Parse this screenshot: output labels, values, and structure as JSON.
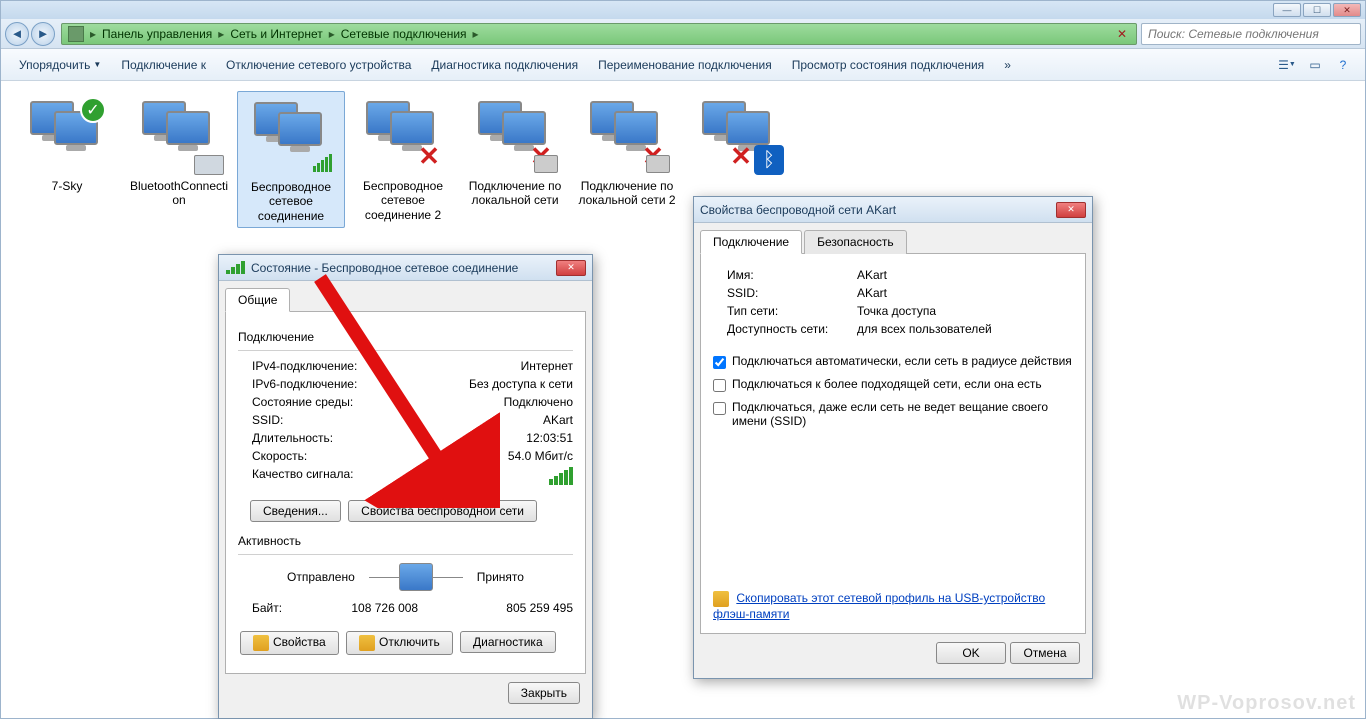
{
  "breadcrumb": {
    "items": [
      "Панель управления",
      "Сеть и Интернет",
      "Сетевые подключения"
    ]
  },
  "search": {
    "placeholder": "Поиск: Сетевые подключения"
  },
  "toolbar": {
    "organize": "Упорядочить",
    "connect": "Подключение к",
    "disable": "Отключение сетевого устройства",
    "diagnose": "Диагностика подключения",
    "rename": "Переименование подключения",
    "status": "Просмотр состояния подключения",
    "more": "»"
  },
  "connections": [
    {
      "label": "7-Sky"
    },
    {
      "label": "BluetoothConnection"
    },
    {
      "label": "Беспроводное сетевое соединение"
    },
    {
      "label": "Беспроводное сетевое соединение 2"
    },
    {
      "label": "Подключение по локальной сети"
    },
    {
      "label": "Подключение по локальной сети 2"
    },
    {
      "label": ""
    }
  ],
  "status_dialog": {
    "title": "Состояние - Беспроводное сетевое соединение",
    "tab_general": "Общие",
    "section_connection": "Подключение",
    "ipv4_label": "IPv4-подключение:",
    "ipv4_value": "Интернет",
    "ipv6_label": "IPv6-подключение:",
    "ipv6_value": "Без доступа к сети",
    "media_label": "Состояние среды:",
    "media_value": "Подключено",
    "ssid_label": "SSID:",
    "ssid_value": "AKart",
    "duration_label": "Длительность:",
    "duration_value": "12:03:51",
    "speed_label": "Скорость:",
    "speed_value": "54.0 Мбит/с",
    "signal_label": "Качество сигнала:",
    "btn_details": "Сведения...",
    "btn_wifi_props": "Свойства беспроводной сети",
    "section_activity": "Активность",
    "sent_label": "Отправлено",
    "recv_label": "Принято",
    "bytes_label": "Байт:",
    "bytes_sent": "108 726 008",
    "bytes_recv": "805 259 495",
    "btn_properties": "Свойства",
    "btn_disable": "Отключить",
    "btn_diagnose": "Диагностика",
    "btn_close": "Закрыть"
  },
  "props_dialog": {
    "title": "Свойства беспроводной сети AKart",
    "tab_connection": "Подключение",
    "tab_security": "Безопасность",
    "name_label": "Имя:",
    "name_value": "AKart",
    "ssid_label": "SSID:",
    "ssid_value": "AKart",
    "nettype_label": "Тип сети:",
    "nettype_value": "Точка доступа",
    "avail_label": "Доступность сети:",
    "avail_value": "для всех пользователей",
    "chk_auto": "Подключаться автоматически, если сеть в радиусе действия",
    "chk_preferred": "Подключаться к более подходящей сети, если она есть",
    "chk_hidden": "Подключаться, даже если сеть не ведет вещание своего имени (SSID)",
    "link_copy": "Скопировать этот сетевой профиль на USB-устройство флэш-памяти",
    "btn_ok": "OK",
    "btn_cancel": "Отмена"
  },
  "watermark": "WP-Voprosov.net"
}
